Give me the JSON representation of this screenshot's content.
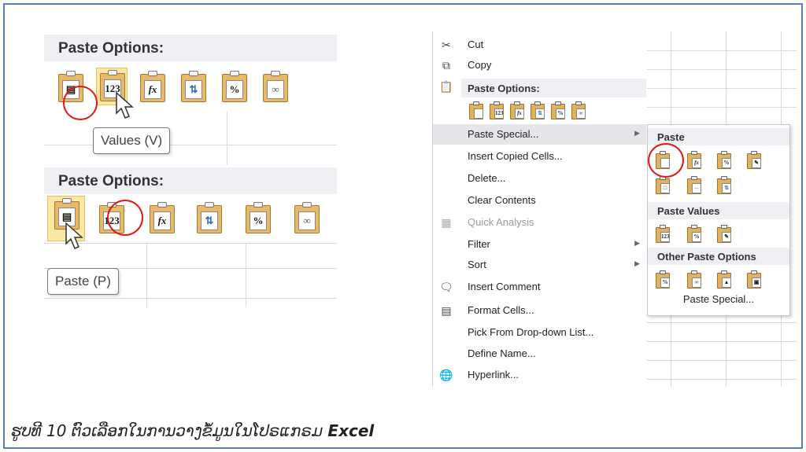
{
  "left_top": {
    "header": "Paste Options:",
    "buttons": [
      "paste",
      "values",
      "formulas",
      "transpose",
      "formatting",
      "paste-link"
    ],
    "values_face": "123",
    "formula_face": "fx",
    "tooltip": "Values (V)"
  },
  "left_bottom": {
    "header": "Paste Options:",
    "values_face": "123",
    "formula_face": "fx",
    "tooltip": "Paste (P)"
  },
  "context_menu": {
    "cut": "Cut",
    "copy": "Copy",
    "paste_options": "Paste Options:",
    "paste_special": "Paste Special...",
    "insert_copied": "Insert Copied Cells...",
    "delete": "Delete...",
    "clear": "Clear Contents",
    "quick_analysis": "Quick Analysis",
    "filter": "Filter",
    "sort": "Sort",
    "insert_comment": "Insert Comment",
    "format_cells": "Format Cells...",
    "pick_list": "Pick From Drop-down List...",
    "define_name": "Define Name...",
    "hyperlink": "Hyperlink..."
  },
  "submenu": {
    "paste": "Paste",
    "paste_values": "Paste Values",
    "other": "Other Paste Options",
    "footer": "Paste Special..."
  },
  "caption": {
    "lao": "ຮູບທີ  10 ຕົວເລືອກໃນການວາງຂໍ້ມູນໃນໂປຣແກຣມ",
    "app": "Excel"
  },
  "colors": {
    "accent_ring": "#e01717",
    "clipboard": "#e8b96a",
    "frame": "#5b7fa6"
  }
}
